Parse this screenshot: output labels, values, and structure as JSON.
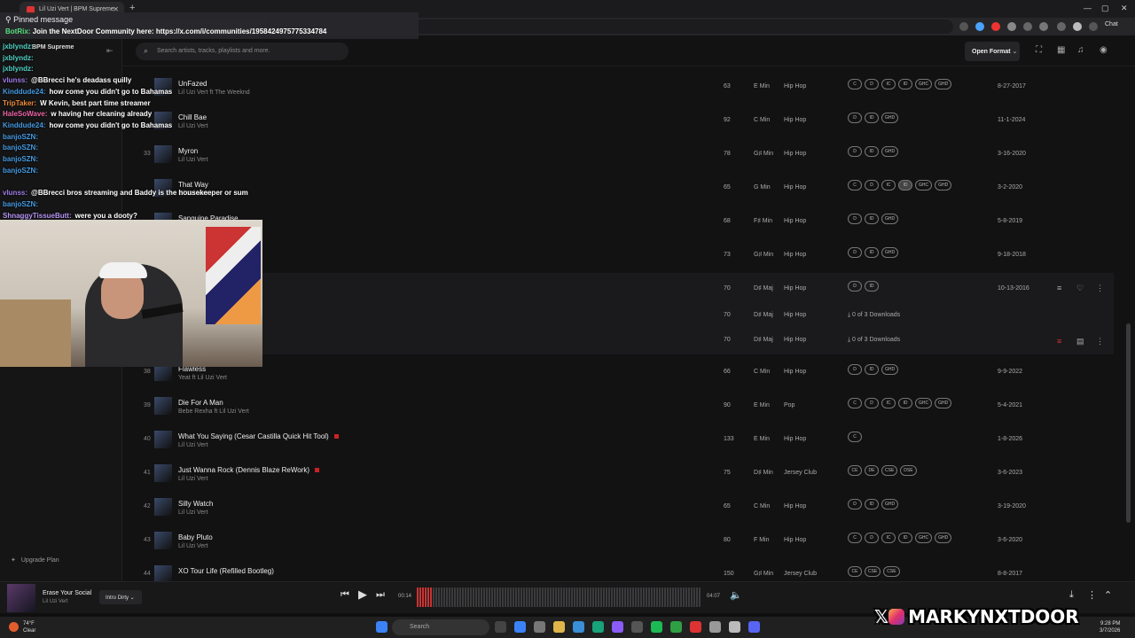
{
  "browser": {
    "tab_title": "Lil Uzi Vert | BPM Supreme",
    "chat_label": "Chat"
  },
  "sidebar": {
    "brand": "BPM Supreme",
    "upgrade_label": "Upgrade Plan"
  },
  "topbar": {
    "search_placeholder": "Search artists, tracks, playlists and more.",
    "open_format_label": "Open Format"
  },
  "tracks": [
    {
      "num": "",
      "title": "UnFazed",
      "artist": "Lil Uzi Vert ft The Weeknd",
      "bpm": "63",
      "key": "E Min",
      "genre": "Hip Hop",
      "versions": [
        "C",
        "D",
        "IC",
        "ID",
        "GHC",
        "GHD"
      ],
      "date": "8-27-2017"
    },
    {
      "num": "",
      "title": "Chill Bae",
      "artist": "Lil Uzi Vert",
      "bpm": "92",
      "key": "C Min",
      "genre": "Hip Hop",
      "versions": [
        "D",
        "ID",
        "GHD"
      ],
      "date": "11-1-2024"
    },
    {
      "num": "33",
      "title": "Myron",
      "artist": "Lil Uzi Vert",
      "bpm": "78",
      "key": "G♯ Min",
      "genre": "Hip Hop",
      "versions": [
        "D",
        "ID",
        "GHD"
      ],
      "date": "3-16-2020"
    },
    {
      "num": "",
      "title": "That Way",
      "artist": "Lil Uzi Vert",
      "bpm": "65",
      "key": "G Min",
      "genre": "Hip Hop",
      "versions": [
        "C",
        "D",
        "IC",
        "ID",
        "GHC",
        "GHD"
      ],
      "date": "3-2-2020"
    },
    {
      "num": "",
      "title": "Sanguine Paradise",
      "artist": "",
      "bpm": "68",
      "key": "F♯ Min",
      "genre": "Hip Hop",
      "versions": [
        "D",
        "ID",
        "GHD"
      ],
      "date": "5-8-2019"
    },
    {
      "num": "",
      "title": "",
      "artist": "",
      "bpm": "73",
      "key": "G♯ Min",
      "genre": "Hip Hop",
      "versions": [
        "D",
        "ID",
        "GHD"
      ],
      "date": "9-18-2018"
    },
    {
      "num": "",
      "title": "",
      "artist": "",
      "bpm": "70",
      "key": "D♯ Maj",
      "genre": "Hip Hop",
      "versions": [
        "D",
        "ID"
      ],
      "date": "10-13-2016"
    },
    {
      "num": "",
      "title": "",
      "artist": "",
      "bpm": "70",
      "key": "D♯ Maj",
      "genre": "Hip Hop",
      "downloads": "0 of 3 Downloads"
    },
    {
      "num": "",
      "title": "",
      "artist": "",
      "bpm": "70",
      "key": "D♯ Maj",
      "genre": "Hip Hop",
      "downloads": "0 of 3 Downloads"
    },
    {
      "num": "38",
      "title": "Flawless",
      "artist": "Yeat ft Lil Uzi Vert",
      "bpm": "66",
      "key": "C Min",
      "genre": "Hip Hop",
      "versions": [
        "D",
        "ID",
        "GHD"
      ],
      "date": "9-9-2022"
    },
    {
      "num": "39",
      "title": "Die For A Man",
      "artist": "Bebe Rexha ft Lil Uzi Vert",
      "bpm": "90",
      "key": "E Min",
      "genre": "Pop",
      "versions": [
        "C",
        "D",
        "IC",
        "ID",
        "GHC",
        "GHD"
      ],
      "date": "5-4-2021"
    },
    {
      "num": "40",
      "title": "What You Saying (Cesar Castilla Quick Hit Tool)",
      "artist": "Lil Uzi Vert",
      "bpm": "133",
      "key": "E Min",
      "genre": "Hip Hop",
      "versions": [
        "C"
      ],
      "date": "1-8-2026"
    },
    {
      "num": "41",
      "title": "Just Wanna Rock (Dennis Blaze ReWork)",
      "artist": "Lil Uzi Vert",
      "bpm": "75",
      "key": "D♯ Min",
      "genre": "Jersey Club",
      "versions": [
        "CE",
        "DE",
        "CSE",
        "DSE"
      ],
      "date": "3-6-2023"
    },
    {
      "num": "42",
      "title": "Silly Watch",
      "artist": "Lil Uzi Vert",
      "bpm": "65",
      "key": "C Min",
      "genre": "Hip Hop",
      "versions": [
        "D",
        "ID",
        "GHD"
      ],
      "date": "3-19-2020"
    },
    {
      "num": "43",
      "title": "Baby Pluto",
      "artist": "Lil Uzi Vert",
      "bpm": "80",
      "key": "F Min",
      "genre": "Hip Hop",
      "versions": [
        "C",
        "D",
        "IC",
        "ID",
        "GHC",
        "GHD"
      ],
      "date": "3-6-2020"
    },
    {
      "num": "44",
      "title": "XO Tour Life (Refilled Bootleg)",
      "artist": "",
      "bpm": "150",
      "key": "G♯ Min",
      "genre": "Jersey Club",
      "versions": [
        "CE",
        "CSE",
        "CSE"
      ],
      "date": "8-8-2017"
    }
  ],
  "player": {
    "title": "Erase Your Social",
    "artist": "Lil Uzi Vert",
    "version": "Intro Dirty",
    "elapsed": "00:14",
    "duration": "04:07",
    "progress": 0.057
  },
  "taskbar": {
    "temp": "74°F",
    "weather": "Clear",
    "search": "Search",
    "time": "9:28 PM",
    "date": "3/7/2026"
  },
  "chat": {
    "pinned_header": "Pinned message",
    "pinned_user": "BotRix:",
    "pinned_text": "Join the NextDoor Community here: https://x.com/i/communities/1958424975775334784",
    "messages": [
      {
        "user": "jxblyndz:",
        "text": "",
        "color": "#4fd1c5"
      },
      {
        "user": "jxblyndz:",
        "text": "",
        "color": "#4fd1c5"
      },
      {
        "user": "jxblyndz:",
        "text": "",
        "color": "#4fd1c5"
      },
      {
        "user": "vlunss:",
        "text": "@BBrecci he's deadass quilly",
        "color": "#9f7aea"
      },
      {
        "user": "Kinddude24:",
        "text": "how come you didn't go to Bahamas",
        "color": "#4299e1"
      },
      {
        "user": "TripTaker:",
        "text": "W Kevin, best part time streamer",
        "color": "#ed8936"
      },
      {
        "user": "HaleSoWave:",
        "text": "w having her cleaning already",
        "color": "#ed64a6"
      },
      {
        "user": "Kinddude24:",
        "text": "how come you didn't go to Bahamas",
        "color": "#4299e1"
      },
      {
        "user": "banjoSZN:",
        "text": "",
        "color": "#4299e1"
      },
      {
        "user": "banjoSZN:",
        "text": "",
        "color": "#4299e1"
      },
      {
        "user": "banjoSZN:",
        "text": "",
        "color": "#4299e1"
      },
      {
        "user": "banjoSZN:",
        "text": "",
        "color": "#4299e1"
      },
      {
        "user": "",
        "text": "",
        "color": "#48bb78"
      },
      {
        "user": "vlunss:",
        "text": "@BBrecci bros streaming and Baddy is the housekeeper or sum",
        "color": "#9f7aea"
      },
      {
        "user": "banjoSZN:",
        "text": "",
        "color": "#4299e1"
      },
      {
        "user": "ShnaggyTissueButt:",
        "text": "were you a dooty?",
        "color": "#b794f4"
      }
    ]
  },
  "watermark": "MARKYNXTDOOR"
}
